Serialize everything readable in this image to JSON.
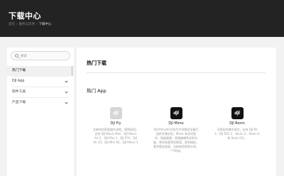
{
  "header": {
    "title": "下载中心",
    "breadcrumbs": [
      "首页",
      "服务与支持",
      "下载中心"
    ]
  },
  "sidebar": {
    "search_placeholder": "搜索",
    "items": [
      {
        "label": "热门下载",
        "active": true,
        "expandable": false
      },
      {
        "label": "DJI App",
        "active": false,
        "expandable": true
      },
      {
        "label": "软件工具",
        "active": false,
        "expandable": true
      },
      {
        "label": "产品下载",
        "active": false,
        "expandable": true
      }
    ]
  },
  "main": {
    "title": "热门下载",
    "section_title": "热门 App",
    "apps": [
      {
        "name": "DJI Fly",
        "icon_text": "dji",
        "icon_bg": "#d6d6d6",
        "description": "全新的机界面操作流程，更简易用。支持 DJI Mavic Mini、DJI Mavic Air 2、DJI Mini 2、DJI FPV、DJI Air 2S、DJI Mini SE、DJI Mavic 3"
      },
      {
        "name": "DJI Mimo",
        "icon_text": "dji",
        "icon_bg": "#121212",
        "description": "DJI Mimo作为DJI为手持稳定设备打造的专属应用，Mimo 有实时图传、智能跟随、视频编辑等多种功能，更多惊喜等您探索。更多精彩，更多稳定画面，全新体验即刻分享，一气呵成。"
      },
      {
        "name": "DJI Ronin",
        "icon_text": "dji",
        "icon_bg": "#121212",
        "description": "可视化的操作体验，支持 DJI RS 2、DJI RSC 2、Ronin 2、Ronin-S 和 Ronin-SC。"
      }
    ]
  }
}
